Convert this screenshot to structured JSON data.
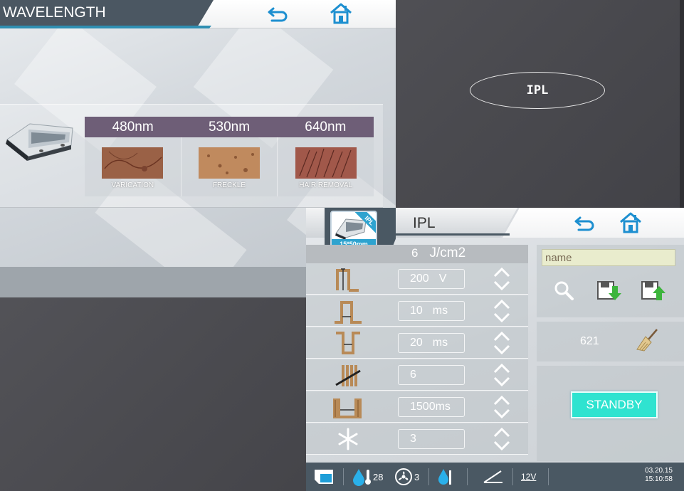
{
  "background": {
    "overlay_label": "IPL"
  },
  "wavelength_screen": {
    "title": "WAVELENGTH",
    "columns": [
      {
        "wavelength": "480nm",
        "label": "VARICATION"
      },
      {
        "wavelength": "530nm",
        "label": "FRECKLE"
      },
      {
        "wavelength": "640nm",
        "label": "HAIR REMOVAL"
      }
    ],
    "icons": {
      "back": "back-arrow-icon",
      "home": "home-icon"
    }
  },
  "ipl_screen": {
    "title": "IPL",
    "handpiece": {
      "badge": "IPL",
      "size": "15*50mm"
    },
    "energy": {
      "value": "6",
      "unit": "J/cm2"
    },
    "params": [
      {
        "icon": "voltage-pulse-icon",
        "value": "200",
        "unit": "V"
      },
      {
        "icon": "pulse-width-icon",
        "value": "10",
        "unit": "ms"
      },
      {
        "icon": "pulse-delay-icon",
        "value": "20",
        "unit": "ms"
      },
      {
        "icon": "pulse-count-icon",
        "value": "6",
        "unit": ""
      },
      {
        "icon": "interval-icon",
        "value": "1500",
        "unit": "ms"
      },
      {
        "icon": "cooling-snowflake-icon",
        "value": "3",
        "unit": ""
      }
    ],
    "name_field": {
      "value": "name"
    },
    "counter": "621",
    "standby_label": "STANDBY",
    "status_bar": {
      "water_temp": "28",
      "fan_level": "3",
      "voltage": "12V",
      "date": "03.20.15",
      "time": "15:10:58"
    },
    "colors": {
      "accent": "#2fe3d0",
      "dark": "#4a5863",
      "blue": "#2ea3cf"
    }
  }
}
